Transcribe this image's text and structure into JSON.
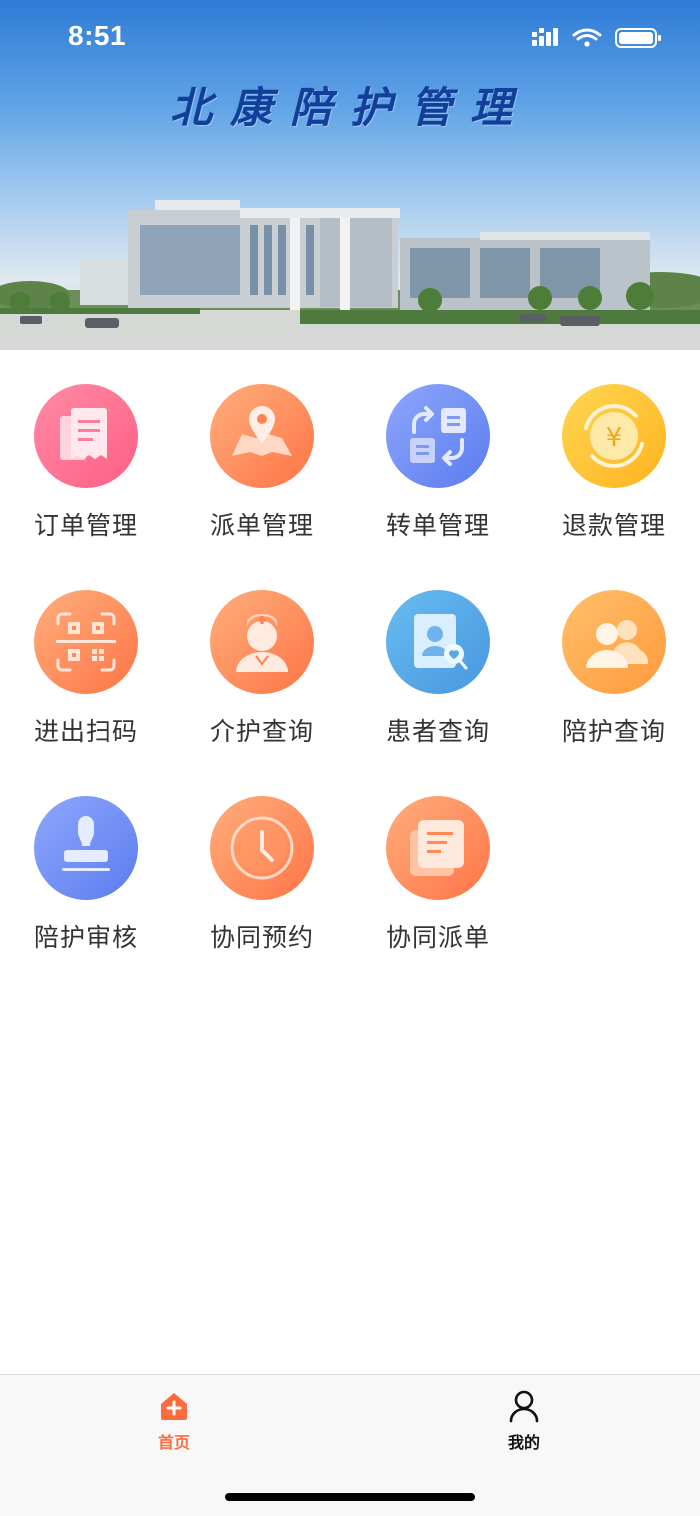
{
  "status_bar": {
    "time": "8:51"
  },
  "banner": {
    "title": "北康陪护管理"
  },
  "menu": [
    {
      "label": "订单管理",
      "icon": "order-receipt-icon",
      "color": "pink"
    },
    {
      "label": "派单管理",
      "icon": "map-pin-icon",
      "color": "orange"
    },
    {
      "label": "转单管理",
      "icon": "transfer-icon",
      "color": "blue"
    },
    {
      "label": "退款管理",
      "icon": "refund-yen-icon",
      "color": "yellow"
    },
    {
      "label": "进出扫码",
      "icon": "qr-scan-icon",
      "color": "orange"
    },
    {
      "label": "介护查询",
      "icon": "nurse-icon",
      "color": "orange"
    },
    {
      "label": "患者查询",
      "icon": "patient-card-icon",
      "color": "teal"
    },
    {
      "label": "陪护查询",
      "icon": "people-icon",
      "color": "amber"
    },
    {
      "label": "陪护审核",
      "icon": "stamp-icon",
      "color": "blue"
    },
    {
      "label": "协同预约",
      "icon": "clock-icon",
      "color": "orange"
    },
    {
      "label": "协同派单",
      "icon": "document-stack-icon",
      "color": "orange"
    }
  ],
  "tabbar": {
    "home": {
      "label": "首页",
      "active": true
    },
    "mine": {
      "label": "我的",
      "active": false
    }
  },
  "colors": {
    "accent": "#ff6b3d",
    "text": "#333333"
  }
}
